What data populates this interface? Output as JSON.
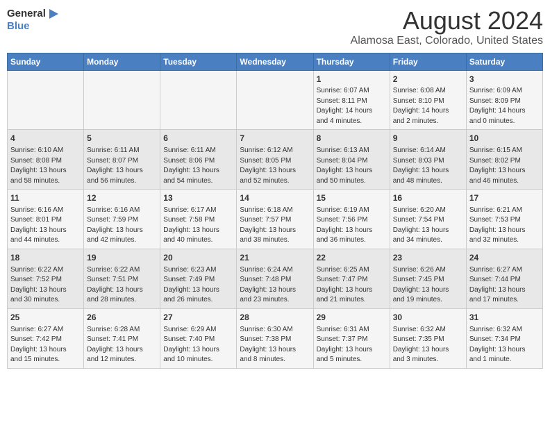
{
  "logo": {
    "line1": "General",
    "line2": "Blue"
  },
  "title": "August 2024",
  "subtitle": "Alamosa East, Colorado, United States",
  "header_color": "#4a7fc1",
  "days_of_week": [
    "Sunday",
    "Monday",
    "Tuesday",
    "Wednesday",
    "Thursday",
    "Friday",
    "Saturday"
  ],
  "weeks": [
    [
      {
        "day": "",
        "content": ""
      },
      {
        "day": "",
        "content": ""
      },
      {
        "day": "",
        "content": ""
      },
      {
        "day": "",
        "content": ""
      },
      {
        "day": "1",
        "content": "Sunrise: 6:07 AM\nSunset: 8:11 PM\nDaylight: 14 hours\nand 4 minutes."
      },
      {
        "day": "2",
        "content": "Sunrise: 6:08 AM\nSunset: 8:10 PM\nDaylight: 14 hours\nand 2 minutes."
      },
      {
        "day": "3",
        "content": "Sunrise: 6:09 AM\nSunset: 8:09 PM\nDaylight: 14 hours\nand 0 minutes."
      }
    ],
    [
      {
        "day": "4",
        "content": "Sunrise: 6:10 AM\nSunset: 8:08 PM\nDaylight: 13 hours\nand 58 minutes."
      },
      {
        "day": "5",
        "content": "Sunrise: 6:11 AM\nSunset: 8:07 PM\nDaylight: 13 hours\nand 56 minutes."
      },
      {
        "day": "6",
        "content": "Sunrise: 6:11 AM\nSunset: 8:06 PM\nDaylight: 13 hours\nand 54 minutes."
      },
      {
        "day": "7",
        "content": "Sunrise: 6:12 AM\nSunset: 8:05 PM\nDaylight: 13 hours\nand 52 minutes."
      },
      {
        "day": "8",
        "content": "Sunrise: 6:13 AM\nSunset: 8:04 PM\nDaylight: 13 hours\nand 50 minutes."
      },
      {
        "day": "9",
        "content": "Sunrise: 6:14 AM\nSunset: 8:03 PM\nDaylight: 13 hours\nand 48 minutes."
      },
      {
        "day": "10",
        "content": "Sunrise: 6:15 AM\nSunset: 8:02 PM\nDaylight: 13 hours\nand 46 minutes."
      }
    ],
    [
      {
        "day": "11",
        "content": "Sunrise: 6:16 AM\nSunset: 8:01 PM\nDaylight: 13 hours\nand 44 minutes."
      },
      {
        "day": "12",
        "content": "Sunrise: 6:16 AM\nSunset: 7:59 PM\nDaylight: 13 hours\nand 42 minutes."
      },
      {
        "day": "13",
        "content": "Sunrise: 6:17 AM\nSunset: 7:58 PM\nDaylight: 13 hours\nand 40 minutes."
      },
      {
        "day": "14",
        "content": "Sunrise: 6:18 AM\nSunset: 7:57 PM\nDaylight: 13 hours\nand 38 minutes."
      },
      {
        "day": "15",
        "content": "Sunrise: 6:19 AM\nSunset: 7:56 PM\nDaylight: 13 hours\nand 36 minutes."
      },
      {
        "day": "16",
        "content": "Sunrise: 6:20 AM\nSunset: 7:54 PM\nDaylight: 13 hours\nand 34 minutes."
      },
      {
        "day": "17",
        "content": "Sunrise: 6:21 AM\nSunset: 7:53 PM\nDaylight: 13 hours\nand 32 minutes."
      }
    ],
    [
      {
        "day": "18",
        "content": "Sunrise: 6:22 AM\nSunset: 7:52 PM\nDaylight: 13 hours\nand 30 minutes."
      },
      {
        "day": "19",
        "content": "Sunrise: 6:22 AM\nSunset: 7:51 PM\nDaylight: 13 hours\nand 28 minutes."
      },
      {
        "day": "20",
        "content": "Sunrise: 6:23 AM\nSunset: 7:49 PM\nDaylight: 13 hours\nand 26 minutes."
      },
      {
        "day": "21",
        "content": "Sunrise: 6:24 AM\nSunset: 7:48 PM\nDaylight: 13 hours\nand 23 minutes."
      },
      {
        "day": "22",
        "content": "Sunrise: 6:25 AM\nSunset: 7:47 PM\nDaylight: 13 hours\nand 21 minutes."
      },
      {
        "day": "23",
        "content": "Sunrise: 6:26 AM\nSunset: 7:45 PM\nDaylight: 13 hours\nand 19 minutes."
      },
      {
        "day": "24",
        "content": "Sunrise: 6:27 AM\nSunset: 7:44 PM\nDaylight: 13 hours\nand 17 minutes."
      }
    ],
    [
      {
        "day": "25",
        "content": "Sunrise: 6:27 AM\nSunset: 7:42 PM\nDaylight: 13 hours\nand 15 minutes."
      },
      {
        "day": "26",
        "content": "Sunrise: 6:28 AM\nSunset: 7:41 PM\nDaylight: 13 hours\nand 12 minutes."
      },
      {
        "day": "27",
        "content": "Sunrise: 6:29 AM\nSunset: 7:40 PM\nDaylight: 13 hours\nand 10 minutes."
      },
      {
        "day": "28",
        "content": "Sunrise: 6:30 AM\nSunset: 7:38 PM\nDaylight: 13 hours\nand 8 minutes."
      },
      {
        "day": "29",
        "content": "Sunrise: 6:31 AM\nSunset: 7:37 PM\nDaylight: 13 hours\nand 5 minutes."
      },
      {
        "day": "30",
        "content": "Sunrise: 6:32 AM\nSunset: 7:35 PM\nDaylight: 13 hours\nand 3 minutes."
      },
      {
        "day": "31",
        "content": "Sunrise: 6:32 AM\nSunset: 7:34 PM\nDaylight: 13 hours\nand 1 minute."
      }
    ]
  ]
}
